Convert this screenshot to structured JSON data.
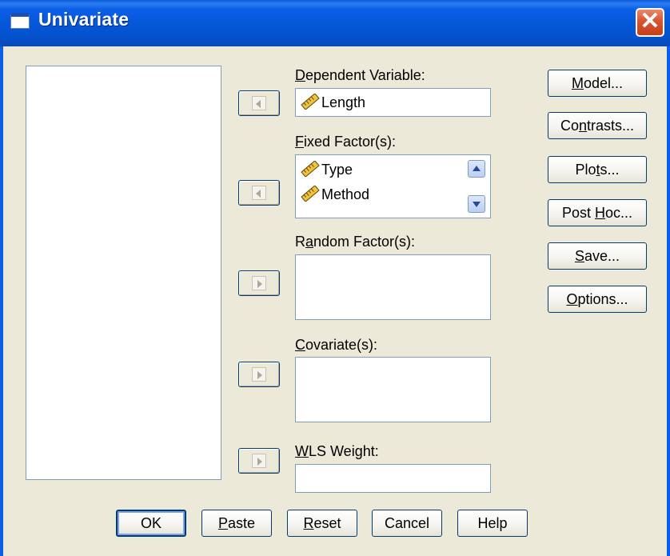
{
  "window": {
    "title": "Univariate",
    "close_glyph": "✕"
  },
  "source_list": {
    "items": []
  },
  "targets": {
    "dependent": {
      "label_pre": "",
      "label_key": "D",
      "label_post": "ependent Variable:",
      "items": [
        "Length"
      ]
    },
    "fixed": {
      "label_pre": "",
      "label_key": "F",
      "label_post": "ixed Factor(s):",
      "items": [
        "Type",
        "Method"
      ]
    },
    "random": {
      "label_pre": "R",
      "label_key": "a",
      "label_post": "ndom Factor(s):",
      "items": []
    },
    "covariates": {
      "label_pre": "",
      "label_key": "C",
      "label_post": "ovariate(s):",
      "items": []
    },
    "wls": {
      "label_pre": "",
      "label_key": "W",
      "label_post": "LS Weight:",
      "items": []
    }
  },
  "side_buttons": {
    "model": {
      "pre": "",
      "key": "M",
      "post": "odel..."
    },
    "contrasts": {
      "pre": "Co",
      "key": "n",
      "post": "trasts..."
    },
    "plots": {
      "pre": "Plo",
      "key": "t",
      "post": "s..."
    },
    "posthoc": {
      "pre": "Post ",
      "key": "H",
      "post": "oc..."
    },
    "save": {
      "pre": "",
      "key": "S",
      "post": "ave..."
    },
    "options": {
      "pre": "",
      "key": "O",
      "post": "ptions..."
    }
  },
  "bottom_buttons": {
    "ok": "OK",
    "paste": {
      "pre": "",
      "key": "P",
      "post": "aste"
    },
    "reset": {
      "pre": "",
      "key": "R",
      "post": "eset"
    },
    "cancel": "Cancel",
    "help": "Help"
  },
  "icons": {
    "variable": "scale-ruler-icon",
    "move_in": "arrow-left-icon",
    "move_out": "arrow-right-icon"
  },
  "colors": {
    "titlebar": "#0558d8",
    "dialog_bg": "#ece9d8",
    "close_button": "#d9542e"
  }
}
